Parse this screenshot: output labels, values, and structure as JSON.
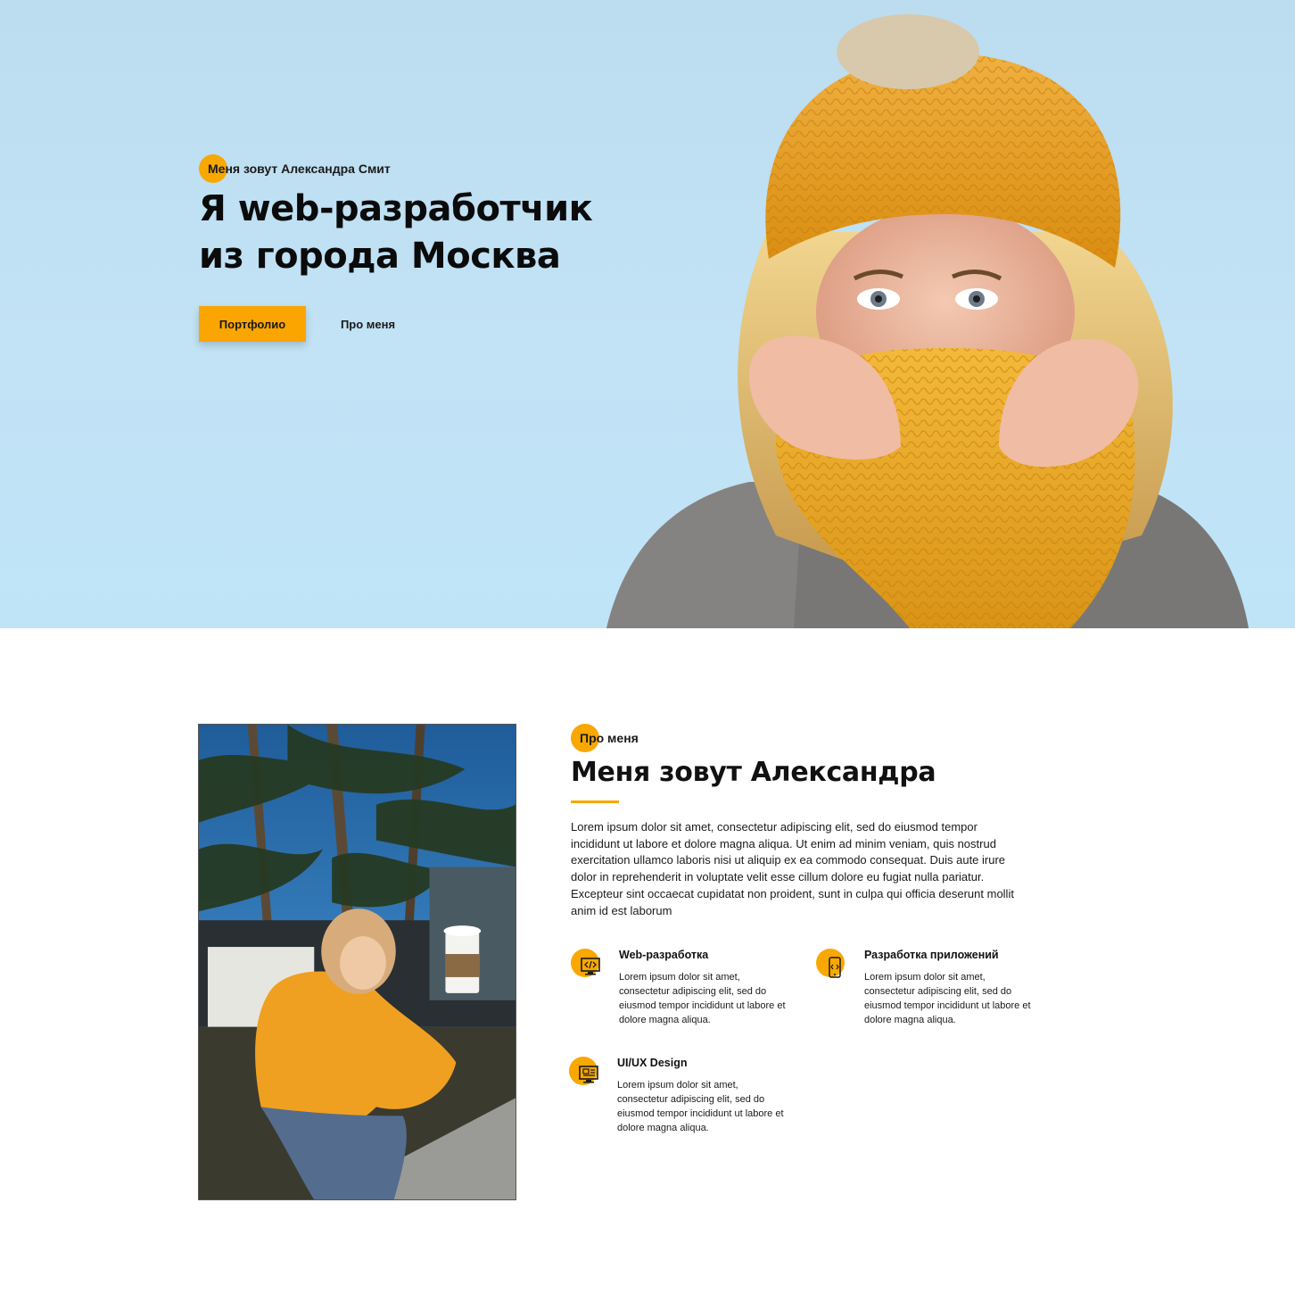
{
  "hero": {
    "eyebrow": "Меня зовут Александра Смит",
    "title_line1": "Я web-разработчик",
    "title_line2": "из города Москва",
    "primary_button": "Портфолио",
    "secondary_button": "Про меня"
  },
  "about": {
    "eyebrow": "Про меня",
    "title": "Меня зовут Александра",
    "text": "Lorem ipsum dolor sit amet, consectetur adipiscing elit, sed do eiusmod tempor incididunt ut labore et dolore magna aliqua. Ut enim ad minim veniam, quis nostrud exercitation ullamco laboris nisi ut aliquip ex ea commodo consequat. Duis aute irure dolor in reprehenderit in voluptate velit esse cillum dolore eu fugiat nulla pariatur. Excepteur sint occaecat cupidatat non proident, sunt in culpa qui officia deserunt mollit anim id est laborum",
    "services": [
      {
        "title": "Web-разработка",
        "text": "Lorem ipsum dolor sit amet, consectetur adipiscing elit, sed do eiusmod tempor incididunt ut labore et dolore magna aliqua.",
        "icon": "monitor-code-icon"
      },
      {
        "title": "Разработка приложений",
        "text": "Lorem ipsum dolor sit amet, consectetur adipiscing elit, sed do eiusmod tempor incididunt ut labore et dolore magna aliqua.",
        "icon": "mobile-code-icon"
      },
      {
        "title": "UI/UX Design",
        "text": "Lorem ipsum dolor sit amet, consectetur adipiscing elit, sed do eiusmod tempor incididunt ut labore et dolore magna aliqua.",
        "icon": "design-screen-icon"
      }
    ]
  },
  "colors": {
    "accent": "#f8a800",
    "hero_bg": "#bfdff3"
  }
}
